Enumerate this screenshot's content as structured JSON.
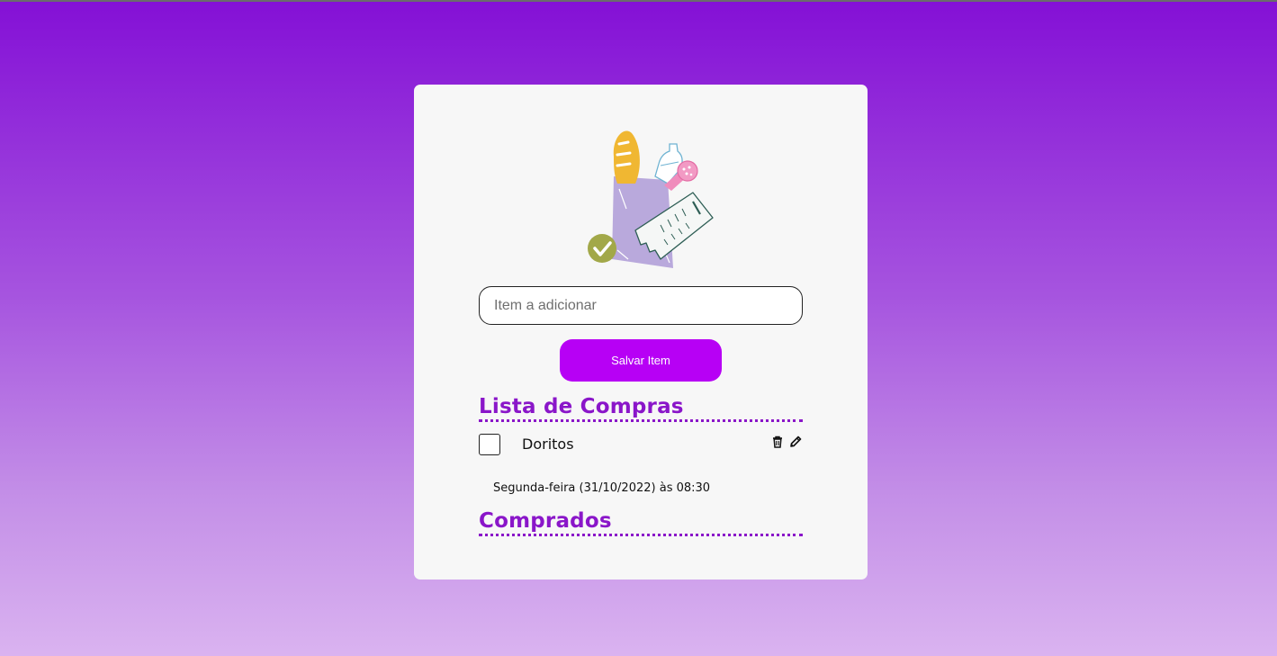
{
  "form": {
    "input_placeholder": "Item a adicionar",
    "input_value": "",
    "save_label": "Salvar Item"
  },
  "shopping_list": {
    "title": "Lista de Compras",
    "items": [
      {
        "name": "Doritos",
        "checked": false,
        "date": "Segunda-feira (31/10/2022) às 08:30",
        "icons": [
          "trash-icon",
          "pencil-icon"
        ]
      }
    ]
  },
  "bought_list": {
    "title": "Comprados",
    "items": []
  },
  "colors": {
    "accent": "#8a16c9",
    "button": "#b700f5",
    "card": "#f7f7f7",
    "gradient_top": "#8410d6",
    "gradient_bottom": "#dab3f0"
  }
}
